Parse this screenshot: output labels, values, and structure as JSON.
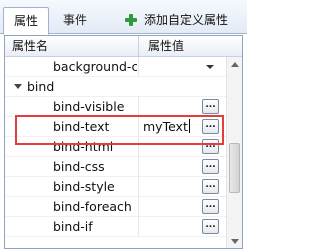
{
  "tabs": {
    "properties": "属性",
    "events": "事件"
  },
  "toolbar": {
    "add_custom_property": "添加自定义属性",
    "add_icon": "plus-icon"
  },
  "grid": {
    "header_name": "属性名",
    "header_value": "属性值",
    "rows": [
      {
        "name": "background-co",
        "value": "",
        "editor": "dropdown"
      },
      {
        "category": "bind"
      },
      {
        "name": "bind-visible",
        "value": "",
        "editor": "ellipsis"
      },
      {
        "name": "bind-text",
        "value": "myText",
        "editor": "ellipsis",
        "editing": true
      },
      {
        "name": "bind-html",
        "value": "",
        "editor": "ellipsis"
      },
      {
        "name": "bind-css",
        "value": "",
        "editor": "ellipsis"
      },
      {
        "name": "bind-style",
        "value": "",
        "editor": "ellipsis"
      },
      {
        "name": "bind-foreach",
        "value": "",
        "editor": "ellipsis"
      },
      {
        "name": "bind-if",
        "value": "",
        "editor": "ellipsis"
      }
    ],
    "ellipsis_label": "...",
    "highlight_color": "#e33d3d"
  }
}
